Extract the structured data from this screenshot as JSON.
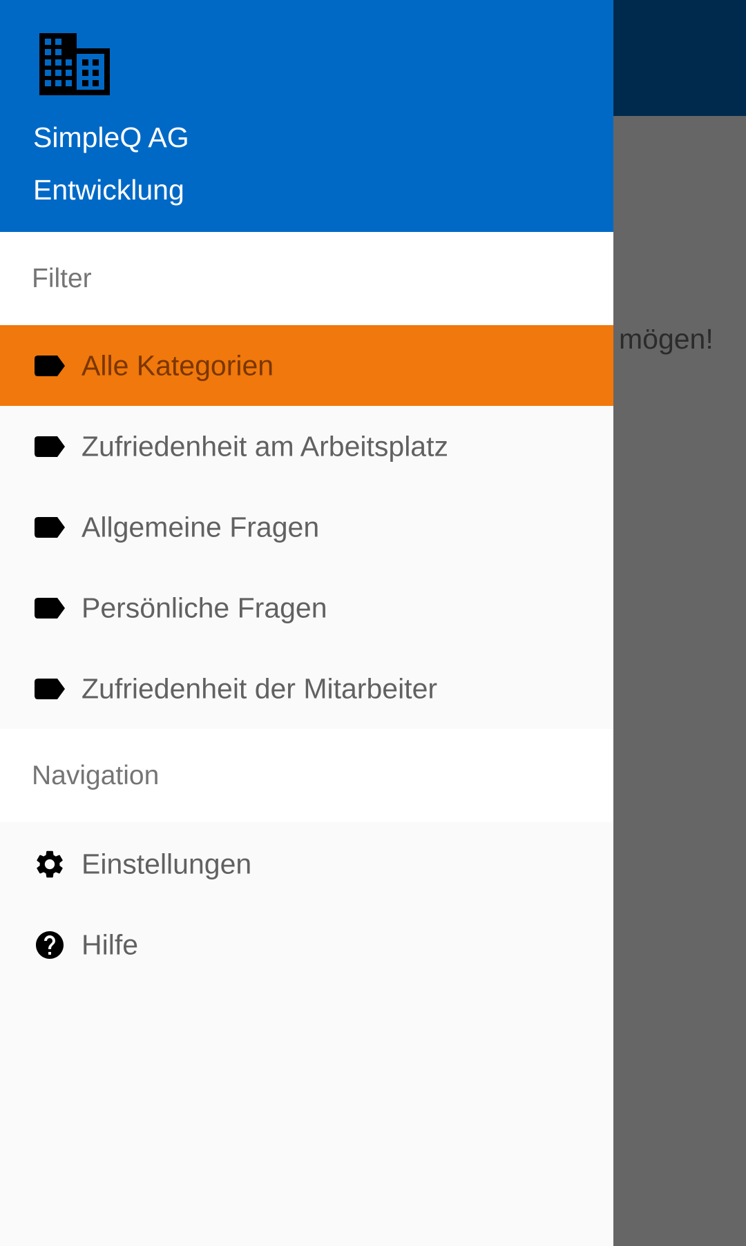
{
  "background": {
    "visible_text": "mögen!"
  },
  "drawer": {
    "header": {
      "icon": "business-building-icon",
      "org_name": "SimpleQ AG",
      "department": "Entwicklung"
    },
    "filter_section": {
      "title": "Filter",
      "items": [
        {
          "label": "Alle Kategorien",
          "icon": "label-tag-icon",
          "selected": true
        },
        {
          "label": "Zufriedenheit am Arbeitsplatz",
          "icon": "label-tag-icon",
          "selected": false
        },
        {
          "label": "Allgemeine Fragen",
          "icon": "label-tag-icon",
          "selected": false
        },
        {
          "label": "Persönliche Fragen",
          "icon": "label-tag-icon",
          "selected": false
        },
        {
          "label": "Zufriedenheit der Mitarbeiter",
          "icon": "label-tag-icon",
          "selected": false
        }
      ]
    },
    "navigation_section": {
      "title": "Navigation",
      "items": [
        {
          "label": "Einstellungen",
          "icon": "gear-icon"
        },
        {
          "label": "Hilfe",
          "icon": "help-circle-icon"
        }
      ]
    }
  },
  "colors": {
    "header_blue": "#0069c6",
    "selected_orange": "#f0780c",
    "background_appbar": "#002a4d",
    "scrim_gray": "#666666"
  }
}
